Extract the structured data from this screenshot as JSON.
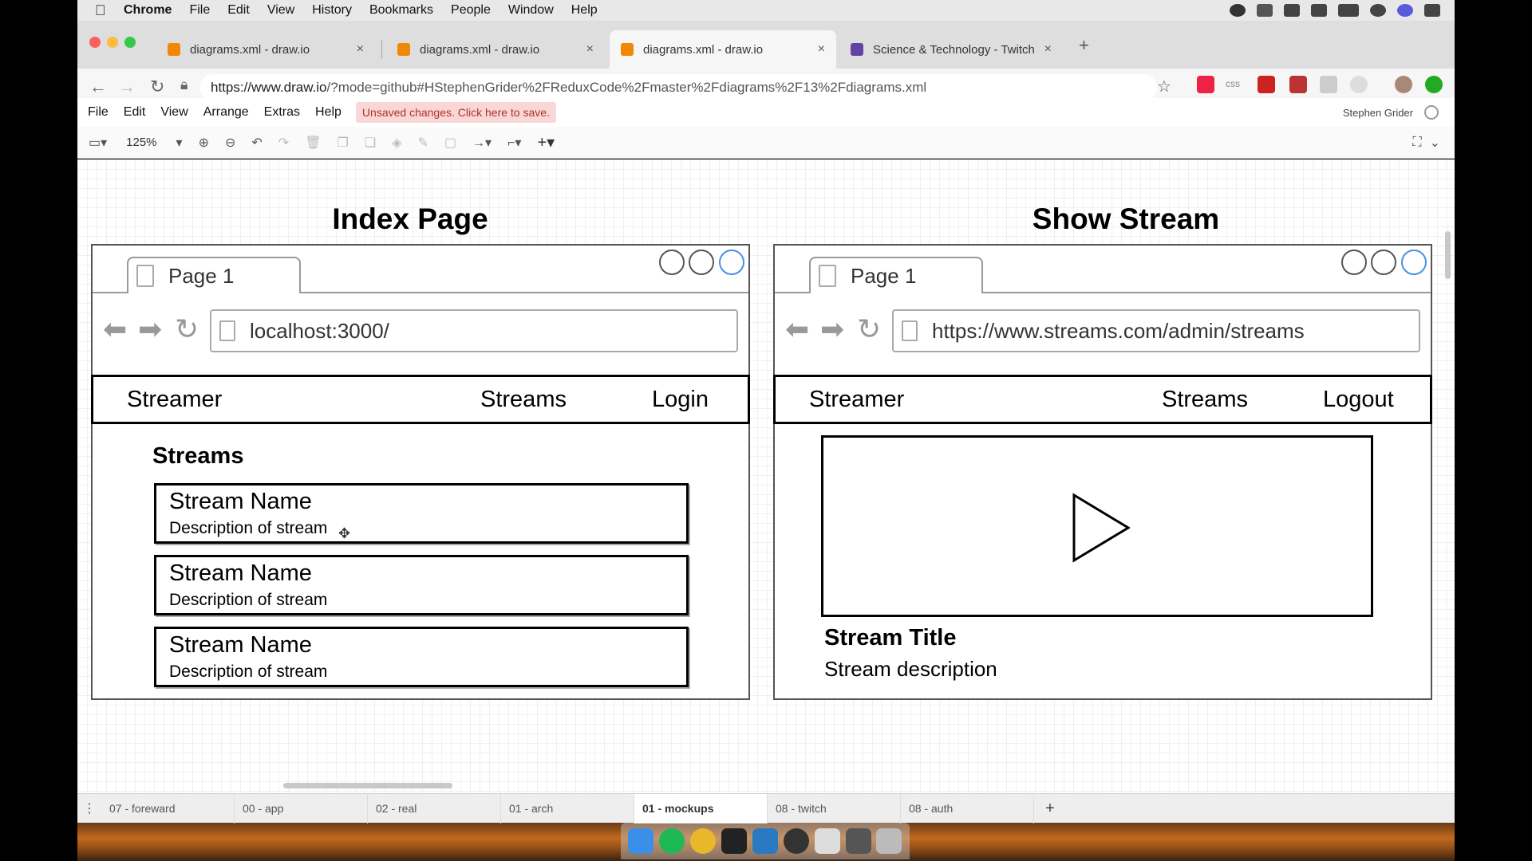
{
  "menubar": {
    "apple": "",
    "items": [
      "Chrome",
      "File",
      "Edit",
      "View",
      "History",
      "Bookmarks",
      "People",
      "Window",
      "Help"
    ]
  },
  "browser": {
    "tabs": [
      {
        "title": "diagrams.xml - draw.io",
        "active": false
      },
      {
        "title": "diagrams.xml - draw.io",
        "active": false
      },
      {
        "title": "diagrams.xml - draw.io",
        "active": true
      },
      {
        "title": "Science & Technology - Twitch",
        "active": false
      }
    ],
    "new_tab": "+",
    "close_glyph": "×",
    "url_host": "https://www.draw.io",
    "url_path": "/?mode=github#HStephenGrider%2FReduxCode%2Fmaster%2Fdiagrams%2F13%2Fdiagrams.xml",
    "extension_css": "css"
  },
  "drawio": {
    "menu": [
      "File",
      "Edit",
      "View",
      "Arrange",
      "Extras",
      "Help"
    ],
    "save_banner": "Unsaved changes. Click here to save.",
    "user": "Stephen Grider",
    "zoom": "125%",
    "page_tabs": [
      {
        "label": "07 - foreward",
        "active": false
      },
      {
        "label": "00 - app",
        "active": false
      },
      {
        "label": "02 - real",
        "active": false
      },
      {
        "label": "01 - arch",
        "active": false
      },
      {
        "label": "01 - mockups",
        "active": true
      },
      {
        "label": "08 - twitch",
        "active": false
      },
      {
        "label": "08 - auth",
        "active": false
      }
    ],
    "add_page": "+"
  },
  "index_mock": {
    "title": "Index Page",
    "tab_label": "Page 1",
    "address": "localhost:3000/",
    "brand": "Streamer",
    "nav_streams": "Streams",
    "nav_auth": "Login",
    "heading": "Streams",
    "cards": [
      {
        "name": "Stream Name",
        "desc": "Description of stream"
      },
      {
        "name": "Stream Name",
        "desc": "Description of stream"
      },
      {
        "name": "Stream Name",
        "desc": "Description of stream"
      }
    ]
  },
  "show_mock": {
    "title": "Show Stream",
    "tab_label": "Page 1",
    "address": "https://www.streams.com/admin/streams",
    "brand": "Streamer",
    "nav_streams": "Streams",
    "nav_auth": "Logout",
    "stream_title": "Stream Title",
    "stream_description": "Stream description"
  },
  "colors": {
    "draw_orange": "#f08705",
    "twitch_purple": "#6441a4",
    "save_banner_bg": "#f8d7d5",
    "circle_blue": "#4a90e2"
  }
}
